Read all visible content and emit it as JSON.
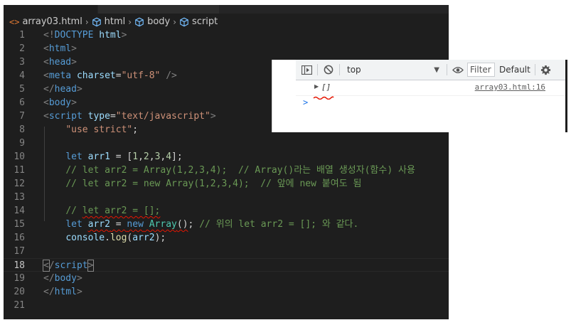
{
  "breadcrumb": {
    "file": "array03.html",
    "file_icon": "<>",
    "items": [
      "html",
      "body",
      "script"
    ]
  },
  "lines": [
    {
      "n": "1",
      "tokens": [
        [
          "br",
          "<!"
        ],
        [
          "tag",
          "DOCTYPE"
        ],
        [
          "plain",
          " "
        ],
        [
          "attr",
          "html"
        ],
        [
          "br",
          ">"
        ]
      ]
    },
    {
      "n": "2",
      "tokens": [
        [
          "br",
          "<"
        ],
        [
          "tag",
          "html"
        ],
        [
          "br",
          ">"
        ]
      ]
    },
    {
      "n": "3",
      "tokens": [
        [
          "br",
          "<"
        ],
        [
          "tag",
          "head"
        ],
        [
          "br",
          ">"
        ]
      ]
    },
    {
      "n": "4",
      "tokens": [
        [
          "br",
          "<"
        ],
        [
          "tag",
          "meta"
        ],
        [
          "plain",
          " "
        ],
        [
          "attr",
          "charset"
        ],
        [
          "plain",
          "="
        ],
        [
          "str",
          "\"utf-8\""
        ],
        [
          "plain",
          " "
        ],
        [
          "br",
          "/>"
        ]
      ]
    },
    {
      "n": "5",
      "tokens": [
        [
          "br",
          "</"
        ],
        [
          "tag",
          "head"
        ],
        [
          "br",
          ">"
        ]
      ]
    },
    {
      "n": "6",
      "tokens": [
        [
          "br",
          "<"
        ],
        [
          "tag",
          "body"
        ],
        [
          "br",
          ">"
        ]
      ]
    },
    {
      "n": "7",
      "tokens": [
        [
          "br",
          "<"
        ],
        [
          "tag",
          "script"
        ],
        [
          "plain",
          " "
        ],
        [
          "attr",
          "type"
        ],
        [
          "plain",
          "="
        ],
        [
          "str",
          "\"text/javascript\""
        ],
        [
          "br",
          ">"
        ]
      ]
    },
    {
      "n": "8",
      "tokens": [
        [
          "plain",
          "    "
        ],
        [
          "str",
          "\"use strict\""
        ],
        [
          "plain",
          ";"
        ]
      ]
    },
    {
      "n": "9",
      "tokens": []
    },
    {
      "n": "10",
      "tokens": [
        [
          "plain",
          "    "
        ],
        [
          "kw",
          "let"
        ],
        [
          "plain",
          " "
        ],
        [
          "var",
          "arr1"
        ],
        [
          "plain",
          " = ["
        ],
        [
          "num",
          "1"
        ],
        [
          "plain",
          ","
        ],
        [
          "num",
          "2"
        ],
        [
          "plain",
          ","
        ],
        [
          "num",
          "3"
        ],
        [
          "plain",
          ","
        ],
        [
          "num",
          "4"
        ],
        [
          "plain",
          "];"
        ]
      ]
    },
    {
      "n": "11",
      "tokens": [
        [
          "plain",
          "    "
        ],
        [
          "com",
          "// let arr2 = Array(1,2,3,4);  // Array()라는 배열 생성자(함수) 사용"
        ]
      ]
    },
    {
      "n": "12",
      "tokens": [
        [
          "plain",
          "    "
        ],
        [
          "com",
          "// let arr2 = new Array(1,2,3,4);  // 앞에 new 붙여도 됨"
        ]
      ]
    },
    {
      "n": "13",
      "tokens": []
    },
    {
      "n": "14",
      "tokens": [
        [
          "plain",
          "    "
        ],
        [
          "com",
          "// "
        ],
        [
          "comsq",
          "let arr2 = [];"
        ]
      ]
    },
    {
      "n": "15",
      "tokens": [
        [
          "plain",
          "    "
        ],
        [
          "kw",
          "let"
        ],
        [
          "plain",
          " "
        ],
        [
          "varsq",
          "arr2"
        ],
        [
          "plainsq",
          " = "
        ],
        [
          "kwsq",
          "new"
        ],
        [
          "plainsq",
          " "
        ],
        [
          "clssq",
          "Array"
        ],
        [
          "plainsq",
          "()"
        ],
        [
          "plain",
          "; "
        ],
        [
          "com",
          "// 위의 let arr2 = []; 와 같다."
        ]
      ]
    },
    {
      "n": "16",
      "tokens": [
        [
          "plain",
          "    "
        ],
        [
          "var",
          "console"
        ],
        [
          "plain",
          "."
        ],
        [
          "fn",
          "log"
        ],
        [
          "plain",
          "("
        ],
        [
          "var",
          "arr2"
        ],
        [
          "plain",
          ");"
        ]
      ]
    },
    {
      "n": "17",
      "tokens": []
    },
    {
      "n": "18",
      "tokens": [
        [
          "brm",
          "<"
        ],
        [
          "br",
          "/"
        ],
        [
          "tag",
          "script"
        ],
        [
          "brm",
          ">"
        ]
      ],
      "current": true
    },
    {
      "n": "19",
      "tokens": [
        [
          "br",
          "</"
        ],
        [
          "tag",
          "body"
        ],
        [
          "br",
          ">"
        ]
      ]
    },
    {
      "n": "20",
      "tokens": [
        [
          "br",
          "</"
        ],
        [
          "tag",
          "html"
        ],
        [
          "br",
          ">"
        ]
      ]
    },
    {
      "n": "21",
      "tokens": []
    }
  ],
  "devtools": {
    "context": "top",
    "filter_placeholder": "Filter",
    "levels": "Default",
    "log_value": "[]",
    "log_source": "array03.html:16",
    "prompt": ">",
    "colors": {
      "toolbar_bg": "#f1f3f4",
      "link": "#5e5e5e",
      "prompt": "#1a73e8"
    }
  }
}
